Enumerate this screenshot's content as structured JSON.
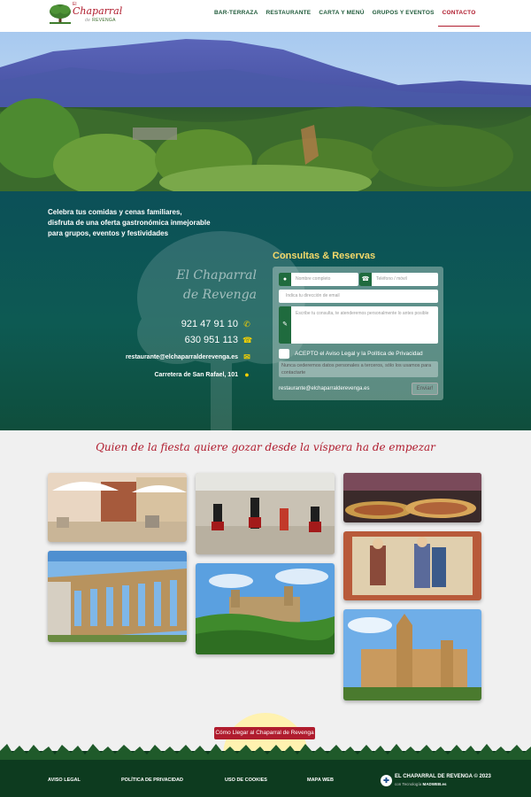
{
  "header": {
    "logo": {
      "line1": "El",
      "line2": "Chaparral",
      "line3_prefix": "de",
      "line3": "REVENGA"
    },
    "nav": [
      {
        "label": "BAR-TERRAZA"
      },
      {
        "label": "RESTAURANTE"
      },
      {
        "label": "CARTA Y MENÚ"
      },
      {
        "label": "GRUPOS Y EVENTOS"
      },
      {
        "label": "CONTACTO"
      }
    ]
  },
  "intro": {
    "line1": "Celebra tus comidas y cenas familiares,",
    "line2": "disfruta de una oferta gastronómica inmejorable",
    "line3": "para grupos, eventos y festividades"
  },
  "contact": {
    "brand_line1": "El Chaparral",
    "brand_line2": "de Revenga",
    "phone1": "921 47 91 10",
    "phone2": "630 951 113",
    "email": "restaurante@elchaparralderevenga.es",
    "address": "Carretera de San Rafael, 101"
  },
  "form": {
    "title": "Consultas & Reservas",
    "name_placeholder": "Nombre completo",
    "tel_placeholder": "Teléfono / móvil",
    "email_placeholder": "Indica tu dirección de email",
    "message_placeholder": "Escribe tu consulta, te atenderemos personalmente lo antes posible",
    "accept_label": "ACEPTO el Aviso Legal y la Política de Privacidad",
    "privacy_notice": "Nunca cederemos datos personales a terceros, sólo los usamos para contactarte",
    "email": "restaurante@elchaparralderevenga.es",
    "send_label": "Enviar!"
  },
  "quote": "Quien de la fiesta quiere gozar desde la víspera ha de empezar",
  "footer": {
    "route_button": "Cómo Llegar al Chaparral de Revenga",
    "links": [
      "AVISO LEGAL",
      "POLÍTICA DE PRIVACIDAD",
      "USO DE COOKIES",
      "MAPA WEB"
    ],
    "copyright": "EL CHAPARRAL DE REVENGA © 2023",
    "tech_prefix": "con Tecnología",
    "tech_brand": "MADWEB.es"
  },
  "icons": {
    "user": "user-icon",
    "phone": "phone-icon",
    "pencil": "pencil-icon",
    "whatsapp": "whatsapp-icon",
    "envelope": "envelope-icon",
    "map_pin": "map-pin-icon"
  },
  "colors": {
    "accent_red": "#b01c2e",
    "brand_green": "#1f6b3e",
    "teal_bg": "#0d5a53",
    "gold": "#f5d000"
  }
}
